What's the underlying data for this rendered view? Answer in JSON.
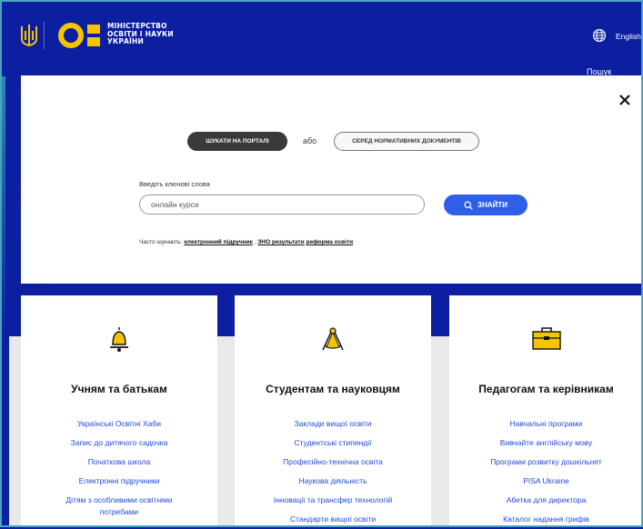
{
  "header": {
    "ministry_lines": [
      "МІНІСТЕРСТВО",
      "ОСВІТИ І НАУКИ",
      "УКРАЇНИ"
    ],
    "language": "English",
    "search_corner": "Пошук"
  },
  "modal": {
    "portal_button": "ШУКАТИ НА ПОРТАЛІ",
    "or": "або",
    "docs_button": "СЕРЕД НОРМАТИВНИХ ДОКУМЕНТІВ",
    "keyword_label": "Введіть ключові слова",
    "search_value": "онлайн курси",
    "find_button": "ЗНАЙТИ",
    "often_label": "Часто шукають:",
    "often_links": [
      "електронний підручник",
      "ЗНО результати",
      "реформа освіти"
    ]
  },
  "cards": [
    {
      "title": "Учням та батькам",
      "icon": "bell-icon",
      "links": [
        "Українські Освітні Хаби",
        "Запис до дитячого садочка",
        "Початкова школа",
        "Електронні підручники",
        "Дітям з особливими освітніми потребами"
      ]
    },
    {
      "title": "Студентам та науковцям",
      "icon": "compass-icon",
      "links": [
        "Заклади вищої освіти",
        "Студентські стипендії",
        "Професійно-технічна освіта",
        "Наукова діяльність",
        "Інновації та трансфер технологій",
        "Стандарти вищої освіти"
      ]
    },
    {
      "title": "Педагогам та керівникам",
      "icon": "briefcase-icon",
      "links": [
        "Навчальні програми",
        "Вивчайте англійську мову",
        "Програми розвитку дошкільнят",
        "PISA Ukraine",
        "Абетка для директора",
        "Каталог надання грифів"
      ]
    }
  ],
  "colors": {
    "brand_blue": "#0c1fa0",
    "accent_yellow": "#f5c400",
    "link_blue": "#1f4bd8",
    "button_blue": "#2f5ee8"
  }
}
